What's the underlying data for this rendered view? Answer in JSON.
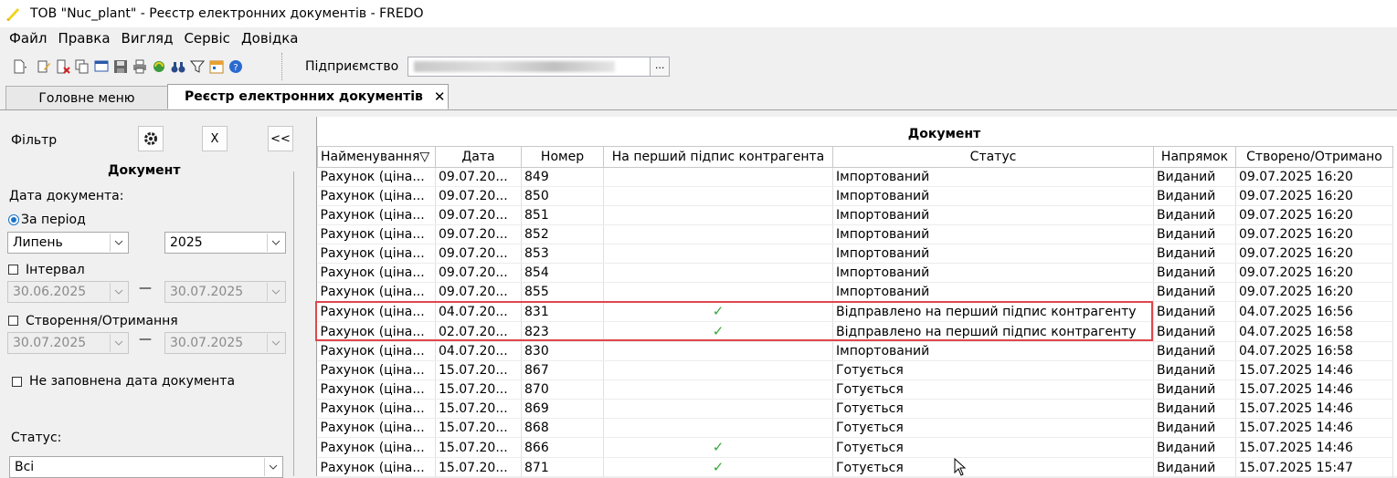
{
  "window": {
    "title": "ТОВ \"Nuc_plant\" - Реєстр електронних документів - FREDO"
  },
  "menu": [
    "Файл",
    "Правка",
    "Вигляд",
    "Сервіс",
    "Довідка"
  ],
  "toolbar": {
    "icons": [
      "new-document-icon",
      "edit-icon",
      "delete-icon",
      "copy-icon",
      "window-icon",
      "save-icon",
      "print-icon",
      "refresh-icon",
      "binoculars-icon",
      "filter-icon",
      "calendar-icon",
      "help-icon"
    ],
    "enterprise_label": "Підприємство",
    "enterprise_button": "..."
  },
  "tabs": [
    {
      "label": "Головне меню",
      "active": false
    },
    {
      "label": "Реєстр електронних документів",
      "active": true,
      "close": "✕"
    }
  ],
  "filter": {
    "title": "Фільтр",
    "clear_button": "X",
    "collapse_button": "<<",
    "section_title": "Документ",
    "doc_date_label": "Дата документа:",
    "period_label": "За період",
    "month": "Липень",
    "year": "2025",
    "interval_label": "Інтервал",
    "interval_from": "30.06.2025",
    "interval_to": "30.07.2025",
    "dash": "—",
    "created_label": "Створення/Отримання",
    "created_from": "30.07.2025",
    "created_to": "30.07.2025",
    "no_date_label": "Не заповнена дата документа",
    "status_label": "Статус:",
    "status_value": "Всі"
  },
  "grid": {
    "group_header": "Документ",
    "columns": [
      "Найменування",
      "Дата",
      "Номер",
      "На перший підпис контрагента",
      "Статус",
      "Напрямок",
      "Створено/Отримано"
    ],
    "sort_indicator": "▽",
    "check_symbol": "✓",
    "rows": [
      {
        "name": "Рахунок (ціна...",
        "date": "09.07.20...",
        "number": "849",
        "first_sign": false,
        "status": "Імпортований",
        "direction": "Виданий",
        "created": "09.07.2025 16:20"
      },
      {
        "name": "Рахунок (ціна...",
        "date": "09.07.20...",
        "number": "850",
        "first_sign": false,
        "status": "Імпортований",
        "direction": "Виданий",
        "created": "09.07.2025 16:20"
      },
      {
        "name": "Рахунок (ціна...",
        "date": "09.07.20...",
        "number": "851",
        "first_sign": false,
        "status": "Імпортований",
        "direction": "Виданий",
        "created": "09.07.2025 16:20"
      },
      {
        "name": "Рахунок (ціна...",
        "date": "09.07.20...",
        "number": "852",
        "first_sign": false,
        "status": "Імпортований",
        "direction": "Виданий",
        "created": "09.07.2025 16:20"
      },
      {
        "name": "Рахунок (ціна...",
        "date": "09.07.20...",
        "number": "853",
        "first_sign": false,
        "status": "Імпортований",
        "direction": "Виданий",
        "created": "09.07.2025 16:20"
      },
      {
        "name": "Рахунок (ціна...",
        "date": "09.07.20...",
        "number": "854",
        "first_sign": false,
        "status": "Імпортований",
        "direction": "Виданий",
        "created": "09.07.2025 16:20"
      },
      {
        "name": "Рахунок (ціна...",
        "date": "09.07.20...",
        "number": "855",
        "first_sign": false,
        "status": "Імпортований",
        "direction": "Виданий",
        "created": "09.07.2025 16:20"
      },
      {
        "name": "Рахунок (ціна...",
        "date": "04.07.20...",
        "number": "831",
        "first_sign": true,
        "status": "Відправлено на перший підпис контрагенту",
        "direction": "Виданий",
        "created": "04.07.2025 16:56"
      },
      {
        "name": "Рахунок (ціна...",
        "date": "02.07.20...",
        "number": "823",
        "first_sign": true,
        "status": "Відправлено на перший підпис контрагенту",
        "direction": "Виданий",
        "created": "04.07.2025 16:58"
      },
      {
        "name": "Рахунок (ціна...",
        "date": "04.07.20...",
        "number": "830",
        "first_sign": false,
        "status": "Імпортований",
        "direction": "Виданий",
        "created": "04.07.2025 16:58"
      },
      {
        "name": "Рахунок (ціна...",
        "date": "15.07.20...",
        "number": "867",
        "first_sign": false,
        "status": "Готується",
        "direction": "Виданий",
        "created": "15.07.2025 14:46"
      },
      {
        "name": "Рахунок (ціна...",
        "date": "15.07.20...",
        "number": "870",
        "first_sign": false,
        "status": "Готується",
        "direction": "Виданий",
        "created": "15.07.2025 14:46"
      },
      {
        "name": "Рахунок (ціна...",
        "date": "15.07.20...",
        "number": "869",
        "first_sign": false,
        "status": "Готується",
        "direction": "Виданий",
        "created": "15.07.2025 14:46"
      },
      {
        "name": "Рахунок (ціна...",
        "date": "15.07.20...",
        "number": "868",
        "first_sign": false,
        "status": "Готується",
        "direction": "Виданий",
        "created": "15.07.2025 14:46"
      },
      {
        "name": "Рахунок (ціна...",
        "date": "15.07.20...",
        "number": "866",
        "first_sign": true,
        "status": "Готується",
        "direction": "Виданий",
        "created": "15.07.2025 14:46"
      },
      {
        "name": "Рахунок (ціна...",
        "date": "15.07.20...",
        "number": "871",
        "first_sign": true,
        "status": "Готується",
        "direction": "Виданий",
        "created": "15.07.2025 15:47"
      }
    ]
  },
  "colors": {
    "highlight": "#e0464c",
    "check": "#3aa63a",
    "radio": "#1a73c8"
  }
}
